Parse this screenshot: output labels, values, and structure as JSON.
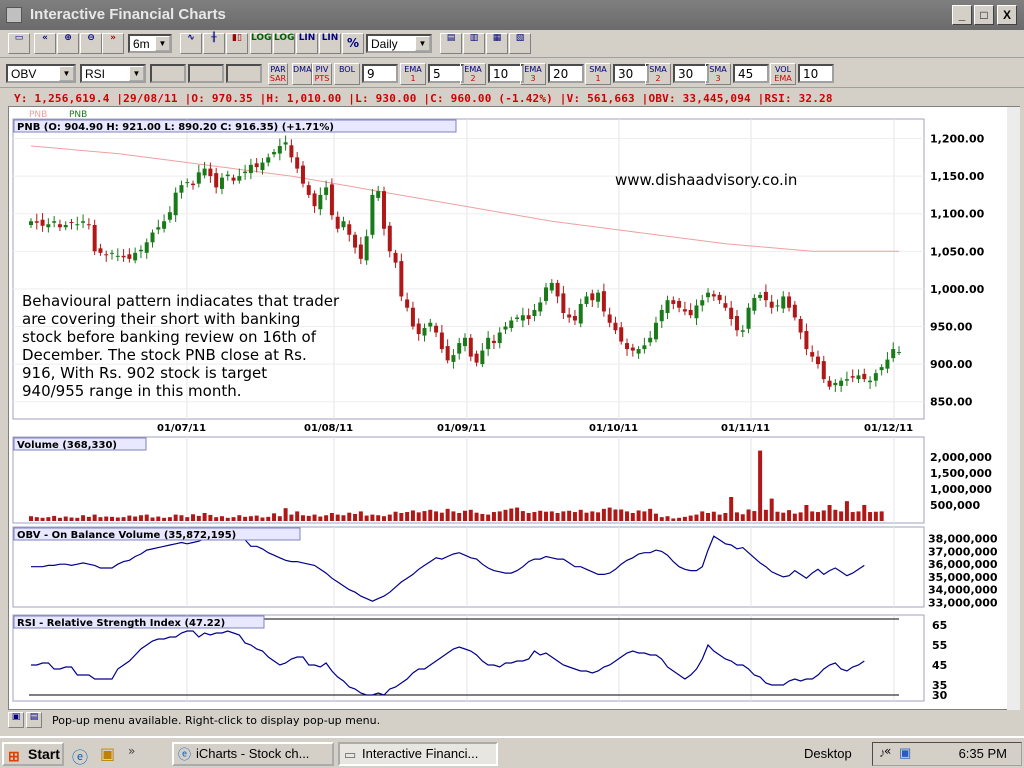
{
  "window": {
    "title": "Interactive Financial Charts",
    "minimize": "_",
    "maximize": "□",
    "close": "X"
  },
  "toolbar": {
    "period": "6m",
    "interval": "Daily",
    "buttons": [
      "LOG",
      "LOG",
      "LIN",
      "LIN",
      "%"
    ]
  },
  "indicators": {
    "ind1": "OBV",
    "ind2": "RSI",
    "params": [
      {
        "label": "PAR\nSAR",
        "value": ""
      },
      {
        "label": "DMA",
        "value": ""
      },
      {
        "label": "PIV\nPTS",
        "value": ""
      },
      {
        "label": "BOL",
        "value": "9"
      },
      {
        "label": "EMA\n1",
        "value": "5"
      },
      {
        "label": "EMA\n2",
        "value": "10"
      },
      {
        "label": "EMA\n3",
        "value": "20"
      },
      {
        "label": "SMA\n1",
        "value": "30"
      },
      {
        "label": "SMA\n2",
        "value": "30"
      },
      {
        "label": "SMA\n3",
        "value": "45"
      },
      {
        "label": "VOL\nEMA",
        "value": "10"
      }
    ]
  },
  "infoline": "Y: 1,256,619.4 |29/08/11 |O: 970.35 |H: 1,010.00 |L: 930.00 |C: 960.00 (-1.42%) |V: 561,663 |OBV: 33,445,094 |RSI: 32.28",
  "legend": {
    "a": "PNB",
    "b": "PNB"
  },
  "price_panel": {
    "header": "PNB (O: 904.90   H: 921.00   L: 890.20   C: 916.35) (+1.71%)",
    "watermark": "www.dishaadvisory.co.in"
  },
  "annotation": [
    "Behavioural pattern indiacates that trader",
    "are covering their short with banking",
    "stock before banking review on 16th of",
    "December. The stock PNB close at Rs.",
    "916, With Rs. 902 stock is target",
    "940/955 range in this month."
  ],
  "volume_panel": {
    "header": "Volume (368,330)"
  },
  "obv_panel": {
    "header": "OBV - On Balance Volume (35,872,195)"
  },
  "rsi_panel": {
    "header": "RSI - Relative Strength Index (47.22)"
  },
  "status": {
    "text": "Pop-up menu available. Right-click to display pop-up menu."
  },
  "taskbar": {
    "start": "Start",
    "task1": "iCharts - Stock ch...",
    "task2": "Interactive Financi...",
    "desktop": "Desktop",
    "time": "6:35 PM"
  },
  "colors": {
    "up": "#1a7a1a",
    "down": "#b01818",
    "line": "#00008b",
    "sma": "#f0a0a0"
  },
  "chart_data": [
    {
      "type": "candlestick",
      "title": "PNB (O: 904.90   H: 921.00   L: 890.20   C: 916.35) (+1.71%)",
      "x_ticks": [
        "01/07/11",
        "01/08/11",
        "01/09/11",
        "01/10/11",
        "01/11/11",
        "01/12/11"
      ],
      "y_ticks": [
        1200,
        1150,
        1100,
        1050,
        1000,
        950,
        900,
        850
      ],
      "ylim": [
        835,
        1210
      ],
      "close": [
        1090,
        1088,
        1084,
        1086,
        1090,
        1082,
        1085,
        1088,
        1086,
        1090,
        1085,
        1050,
        1048,
        1045,
        1048,
        1044,
        1042,
        1040,
        1048,
        1052,
        1062,
        1075,
        1082,
        1090,
        1102,
        1128,
        1138,
        1142,
        1138,
        1155,
        1160,
        1150,
        1135,
        1148,
        1152,
        1144,
        1150,
        1156,
        1165,
        1162,
        1168,
        1175,
        1182,
        1190,
        1195,
        1175,
        1160,
        1140,
        1125,
        1110,
        1125,
        1135,
        1098,
        1080,
        1090,
        1072,
        1055,
        1040,
        1070,
        1125,
        1130,
        1080,
        1050,
        1035,
        990,
        975,
        950,
        940,
        948,
        955,
        942,
        920,
        905,
        912,
        928,
        935,
        910,
        902,
        918,
        935,
        928,
        942,
        950,
        958,
        962,
        965,
        960,
        972,
        982,
        1002,
        1008,
        990,
        968,
        962,
        958,
        980,
        990,
        985,
        995,
        970,
        955,
        945,
        930,
        920,
        918,
        920,
        925,
        935,
        955,
        972,
        985,
        980,
        975,
        970,
        965,
        978,
        985,
        995,
        990,
        985,
        975,
        960,
        945,
        945,
        975,
        988,
        992,
        985,
        975,
        978,
        990,
        975,
        962,
        942,
        920,
        910,
        900,
        880,
        870,
        875,
        878,
        880,
        882,
        885,
        880,
        878,
        888,
        896,
        906,
        920,
        916
      ],
      "volume": [
        150000,
        120000,
        100000,
        120000,
        160000,
        100000,
        140000,
        110000,
        100000,
        180000,
        130000,
        200000,
        120000,
        140000,
        130000,
        110000,
        120000,
        170000,
        140000,
        180000,
        200000,
        110000,
        140000,
        100000,
        120000,
        200000,
        180000,
        120000,
        210000,
        160000,
        250000,
        190000,
        120000,
        150000,
        100000,
        120000,
        180000,
        130000,
        150000,
        170000,
        110000,
        130000,
        240000,
        150000,
        400000,
        200000,
        300000,
        180000,
        160000,
        200000,
        140000,
        180000,
        250000,
        200000,
        180000,
        260000,
        220000,
        300000,
        170000,
        200000,
        180000,
        150000,
        200000,
        290000,
        250000,
        280000,
        330000,
        270000,
        310000,
        350000,
        300000,
        260000,
        380000,
        300000,
        250000,
        320000,
        350000,
        260000,
        220000,
        200000,
        280000,
        300000,
        350000,
        390000,
        420000,
        310000,
        250000,
        280000,
        320000,
        290000,
        300000,
        250000,
        300000,
        320000,
        280000,
        350000,
        260000,
        300000,
        270000,
        380000,
        420000,
        360000,
        360000,
        300000,
        250000,
        330000,
        300000,
        380000,
        230000,
        120000,
        150000,
        80000,
        100000,
        130000,
        170000,
        200000,
        300000,
        250000,
        290000,
        200000,
        250000,
        750000,
        270000,
        210000,
        360000,
        310000,
        2200000,
        350000,
        700000,
        290000,
        260000,
        340000,
        230000,
        270000,
        500000,
        300000,
        280000,
        330000,
        500000,
        350000,
        300000,
        620000,
        280000,
        300000,
        500000,
        280000,
        290000,
        300000
      ],
      "obv_ylim": [
        32800000,
        38600000
      ],
      "obv_ticks": [
        38000000,
        37000000,
        36000000,
        35000000,
        34000000,
        33000000
      ],
      "obv": [
        35.8,
        35.8,
        35.8,
        35.9,
        35.9,
        36.0,
        36.0,
        35.9,
        36.0,
        36.1,
        36.0,
        35.9,
        35.7,
        35.7,
        35.7,
        36.0,
        36.2,
        36.3,
        36.6,
        36.8,
        37.1,
        37.2,
        37.3,
        37.4,
        37.5,
        37.6,
        37.7,
        37.6,
        37.7,
        37.8,
        38.0,
        38.0,
        38.1,
        38.2,
        38.3,
        38.1,
        38.2,
        37.9,
        37.4,
        37.4,
        37.2,
        36.9,
        36.7,
        36.5,
        36.3,
        36.2,
        36.2,
        36.1,
        36.0,
        35.9,
        35.6,
        35.3,
        34.9,
        34.6,
        34.3,
        34.0,
        33.8,
        33.5,
        33.3,
        33.1,
        33.3,
        33.5,
        33.8,
        34.2,
        34.6,
        34.9,
        35.2,
        35.6,
        35.9,
        36.2,
        36.5,
        36.4,
        36.6,
        36.8,
        36.9,
        36.7,
        36.5,
        36.4,
        36.0,
        35.7,
        35.5,
        35.4,
        35.3,
        35.3,
        35.5,
        35.8,
        36.2,
        36.4,
        36.4,
        36.6,
        36.5,
        36.4,
        36.4,
        36.1,
        35.8,
        35.8,
        35.6,
        35.4,
        35.2,
        35.2,
        35.3,
        35.6,
        36.0,
        36.3,
        36.5,
        36.8,
        36.9,
        36.9,
        37.1,
        37.0,
        36.7,
        36.2,
        35.8,
        35.6,
        35.5,
        35.5,
        35.8,
        37.1,
        38.2,
        37.9,
        37.6,
        37.5,
        37.2,
        37.3,
        36.9,
        36.5,
        36.1,
        35.8,
        35.4,
        35.2,
        35.0,
        35.1,
        35.5,
        35.2,
        34.9,
        35.3,
        35.6,
        35.2,
        35.5,
        35.7,
        35.4,
        35.1,
        35.3,
        35.6,
        35.9
      ],
      "rsi_ylim": [
        28,
        68
      ],
      "rsi_ticks": [
        65,
        55,
        45,
        35,
        30
      ],
      "rsi": [
        45,
        45,
        46,
        46,
        43,
        43,
        44,
        44,
        40,
        40,
        40,
        38,
        38,
        38,
        38,
        43,
        45,
        47,
        50,
        53,
        55,
        57,
        58,
        58,
        59,
        59,
        61,
        62,
        62,
        59,
        61,
        60,
        61,
        61,
        62,
        61,
        60,
        56,
        55,
        53,
        52,
        49,
        47,
        45,
        46,
        48,
        49,
        49,
        45,
        45,
        44,
        46,
        42,
        39,
        37,
        34,
        33,
        31,
        30,
        30,
        31,
        30,
        33,
        34,
        36,
        38,
        41,
        43,
        43,
        45,
        47,
        49,
        51,
        53,
        54,
        53,
        52,
        50,
        47,
        45,
        45,
        44,
        46,
        46,
        47,
        47,
        48,
        52,
        50,
        51,
        49,
        47,
        45,
        44,
        43,
        42,
        42,
        41,
        42,
        44,
        45,
        47,
        49,
        51,
        52,
        51,
        51,
        50,
        50,
        48,
        44,
        42,
        40,
        38,
        40,
        43,
        48,
        55,
        52,
        50,
        48,
        47,
        45,
        45,
        43,
        40,
        39,
        36,
        35,
        35,
        35,
        37,
        38,
        37,
        38,
        38,
        40,
        43,
        45,
        46,
        43,
        42,
        44,
        45,
        47
      ]
    }
  ]
}
